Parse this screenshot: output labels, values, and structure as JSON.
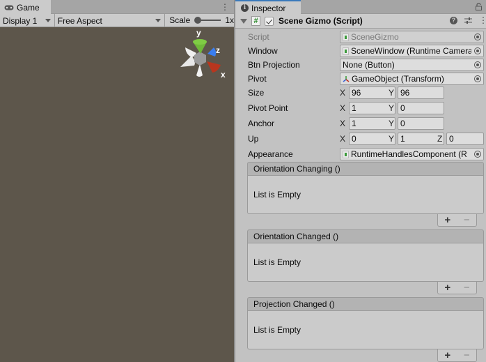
{
  "game": {
    "tab_label": "Game",
    "tab_icon": "gamepad-icon",
    "display_value": "Display 1",
    "aspect_value": "Free Aspect",
    "scale_label": "Scale",
    "scale_value": "1x",
    "scale_slider_fraction": 0.0,
    "gizmo": {
      "y_label": "y",
      "z_label": "z",
      "x_label": "x",
      "colors": {
        "y": "#6fb83a",
        "z": "#3a7ef0",
        "x": "#b8361e",
        "neutral": "#e8e8e8",
        "center": "#9a9a9a"
      }
    },
    "background": "#5d564b"
  },
  "inspector": {
    "tab_label": "Inspector",
    "component": {
      "title": "Scene Gizmo (Script)",
      "enabled": true
    },
    "fields": {
      "script": {
        "label": "Script",
        "value": "SceneGizmo"
      },
      "window": {
        "label": "Window",
        "value": "SceneWindow (Runtime Camera)"
      },
      "btn_projection": {
        "label": "Btn Projection",
        "value": "None (Button)"
      },
      "pivot": {
        "label": "Pivot",
        "value": "GameObject (Transform)"
      },
      "size": {
        "label": "Size",
        "x": "96",
        "y": "96"
      },
      "pivot_point": {
        "label": "Pivot Point",
        "x": "1",
        "y": "0"
      },
      "anchor": {
        "label": "Anchor",
        "x": "1",
        "y": "0"
      },
      "up": {
        "label": "Up",
        "x": "0",
        "y": "1",
        "z": "0"
      },
      "appearance": {
        "label": "Appearance",
        "value": "RuntimeHandlesComponent (R"
      }
    },
    "axes": {
      "x": "X",
      "y": "Y",
      "z": "Z"
    },
    "events": [
      {
        "title": "Orientation Changing ()",
        "empty_text": "List is Empty"
      },
      {
        "title": "Orientation Changed ()",
        "empty_text": "List is Empty"
      },
      {
        "title": "Projection Changed ()",
        "empty_text": "List is Empty"
      }
    ],
    "add_label": "+",
    "remove_label": "−",
    "accent": "#3a79bb"
  }
}
